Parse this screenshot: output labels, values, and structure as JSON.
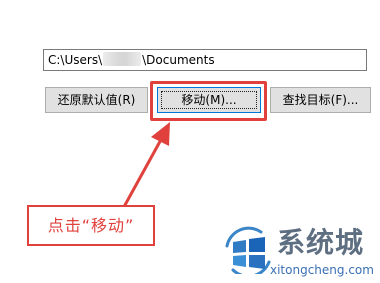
{
  "path": {
    "prefix": "C:\\Users\\",
    "suffix": "\\Documents"
  },
  "buttons": {
    "restore_label": "还原默认值(R)",
    "move_label": "移动(M)...",
    "find_label": "查找目标(F)..."
  },
  "annotation": {
    "callout_text": "点击“移动”",
    "color": "#e0413c"
  },
  "watermark": {
    "name": "系统城",
    "url": "xitongcheng.com",
    "icon": "windows-logo-icon"
  }
}
